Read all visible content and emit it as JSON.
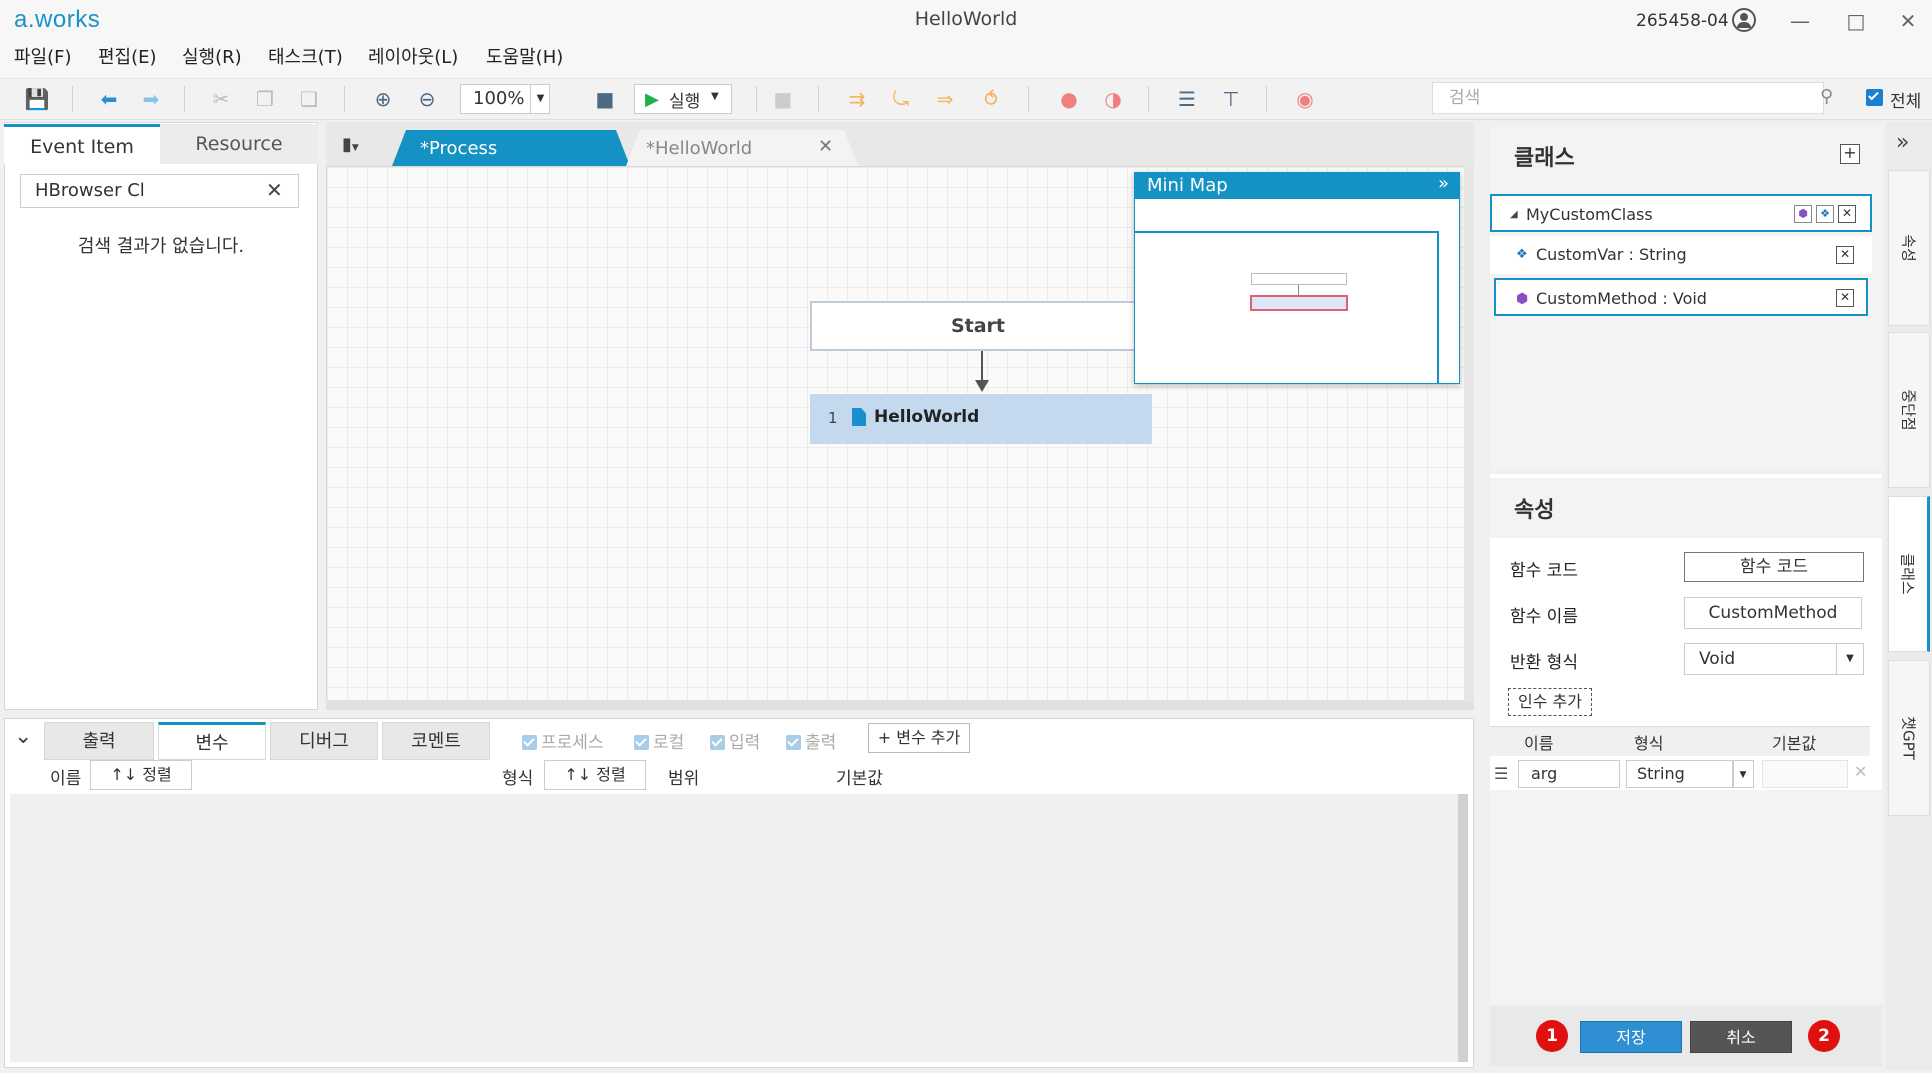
{
  "app": {
    "logo": "a.works",
    "window_title": "HelloWorld",
    "user_id": "265458-04"
  },
  "menu": {
    "items": [
      "파일(F)",
      "편집(E)",
      "실행(R)",
      "태스크(T)",
      "레이아웃(L)",
      "도움말(H)"
    ]
  },
  "toolbar": {
    "zoom": "100%",
    "run_label": "실행",
    "search_placeholder": "검색",
    "all_label": "전체"
  },
  "left_panel": {
    "tabs": [
      "Event Item",
      "Resource"
    ],
    "search_value": "HBrowser Cl",
    "empty_message": "검색 결과가 없습니다."
  },
  "editor": {
    "tabs": [
      "*Process",
      "*HelloWorld"
    ],
    "start_label": "Start",
    "step_number": "1",
    "step_label": "HelloWorld",
    "minimap_title": "Mini Map"
  },
  "bottom_panel": {
    "tabs": [
      "출력",
      "변수",
      "디버그",
      "코멘트"
    ],
    "filters": [
      "프로세스",
      "로컬",
      "입력",
      "출력"
    ],
    "add_variable": "+ 변수 추가",
    "columns": {
      "name": "이름",
      "sort": "↑↓ 정렬",
      "type": "형식",
      "scope": "범위",
      "default": "기본값"
    }
  },
  "class_panel": {
    "title": "클래스",
    "class_name": "MyCustomClass",
    "variable": "CustomVar : String",
    "method": "CustomMethod : Void"
  },
  "property_panel": {
    "title": "속성",
    "function_code_label": "함수 코드",
    "function_code_button": "함수 코드",
    "function_name_label": "함수 이름",
    "function_name_value": "CustomMethod",
    "return_type_label": "반환 형식",
    "return_type_value": "Void",
    "add_argument": "인수 추가",
    "arg_columns": [
      "이름",
      "형식",
      "기본값"
    ],
    "arg_name": "arg",
    "arg_type": "String",
    "save": "저장",
    "cancel": "취소",
    "badge1": "1",
    "badge2": "2"
  },
  "side_tabs": [
    "속성",
    "중단점",
    "클래스",
    "챗GPT"
  ],
  "colors": {
    "accent": "#1592c4",
    "step_fill": "#c4d9ee",
    "save_button": "#2e8fd3",
    "badge": "#e01010"
  }
}
